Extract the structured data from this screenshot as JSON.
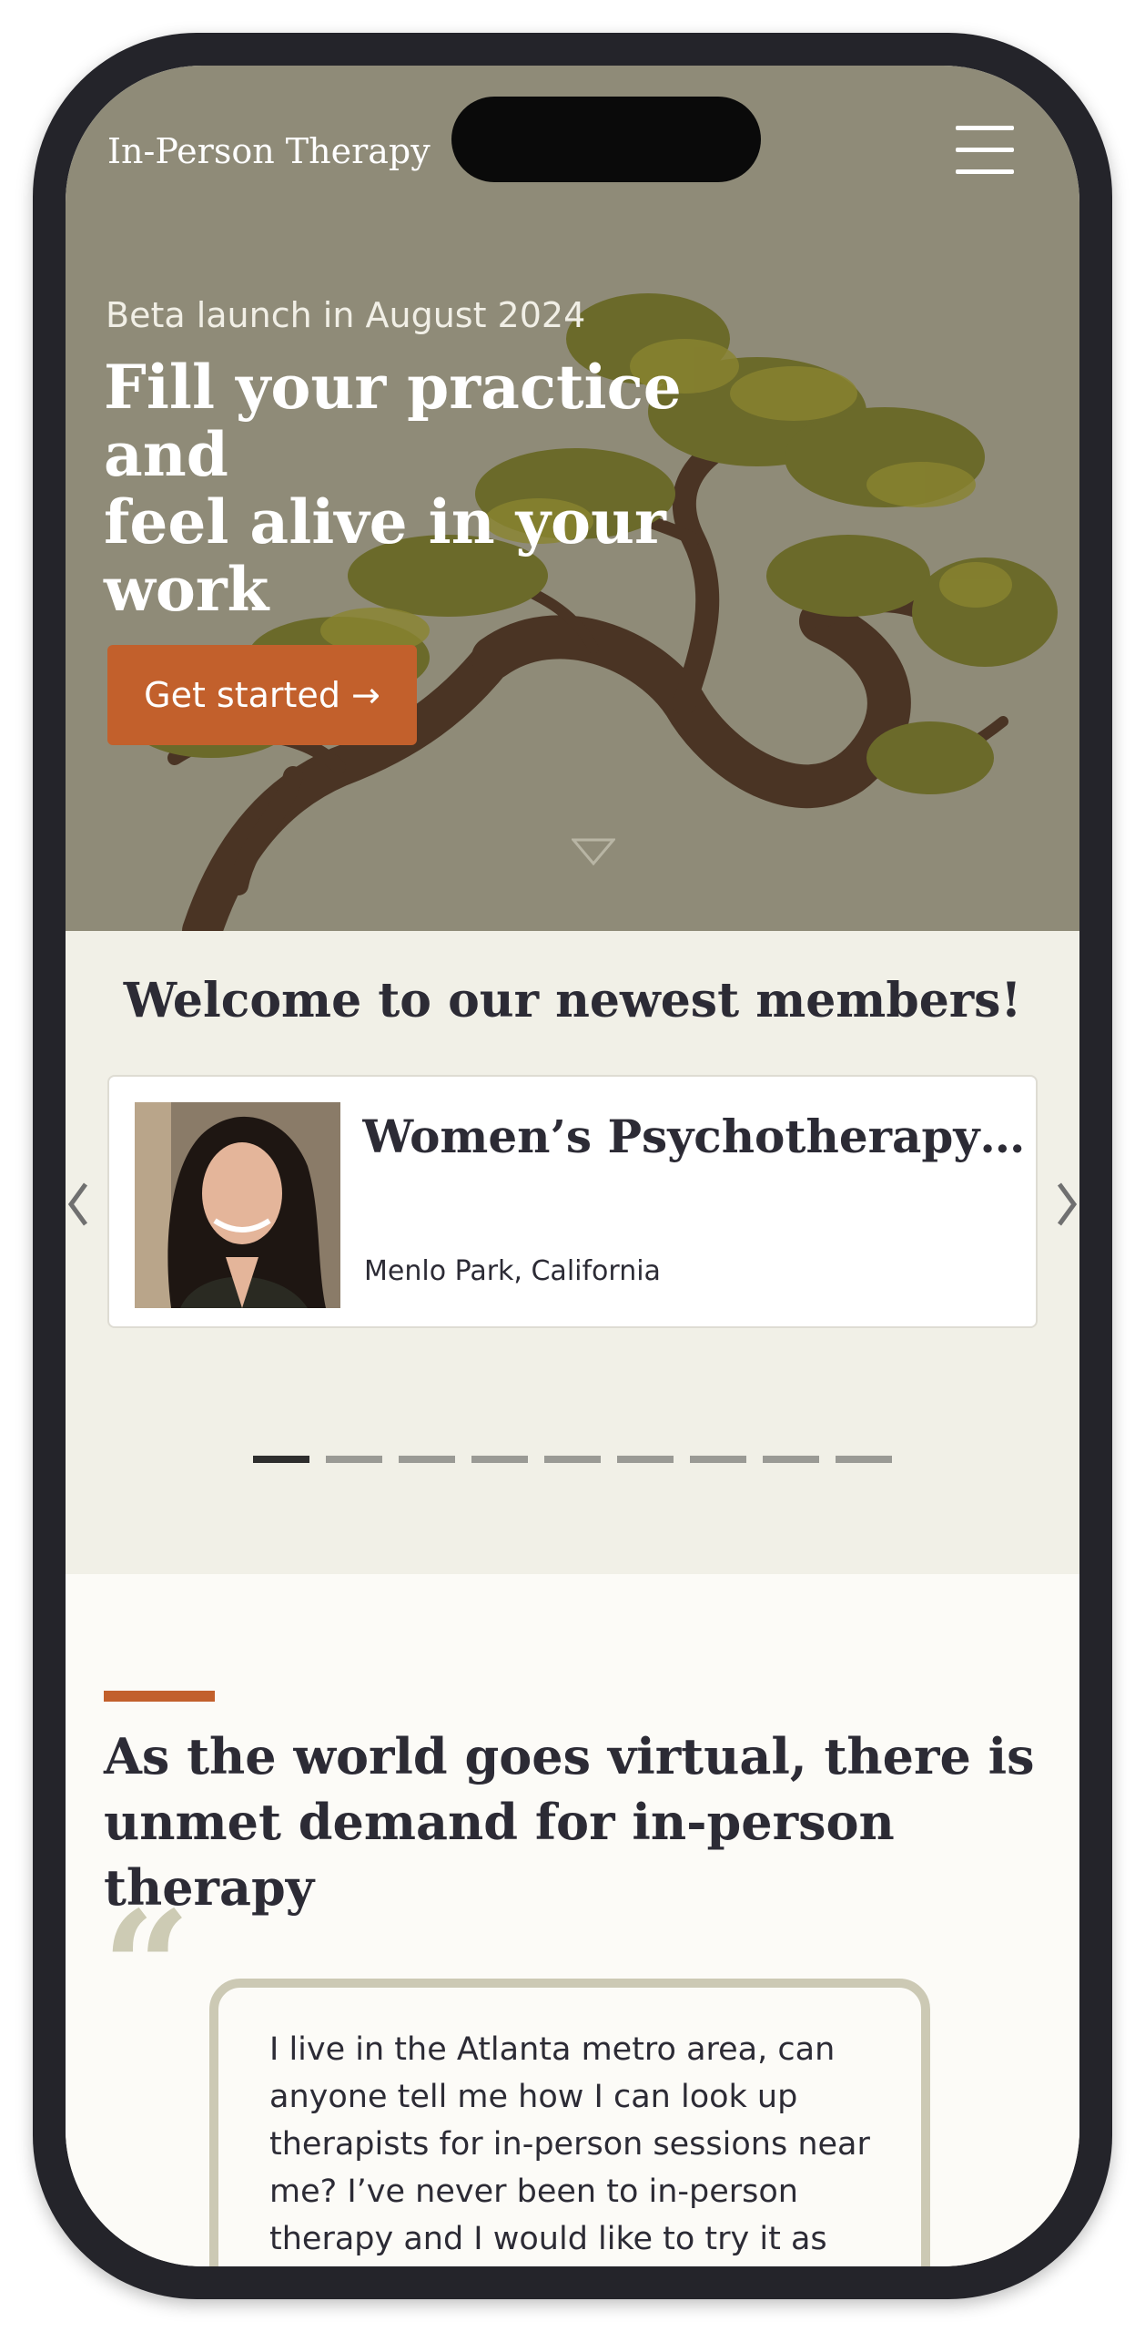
{
  "header": {
    "site_title": "In-Person Therapy",
    "menu_icon": "hamburger-menu-icon"
  },
  "hero": {
    "eyebrow": "Beta launch in August 2024",
    "headline_lines": [
      "Fill your practice and",
      "feel alive in your",
      "work"
    ],
    "cta_label": "Get started →",
    "scroll_icon": "chevron-down-icon"
  },
  "members": {
    "title": "Welcome to our newest members!",
    "card": {
      "name": "Women’s Psychotherapy & Wellness",
      "location": "Menlo Park, California"
    },
    "carousel": {
      "total_slides": 9,
      "active_slide": 1
    }
  },
  "virtual": {
    "title_lines": [
      "As the world goes virtual, there is",
      "unmet demand for in-person therapy"
    ],
    "quote_mark": "“",
    "quote_text": "I live in the Atlanta metro area, can anyone tell me how I can look up therapists for in-person sessions near me? I’ve never been to in-person therapy and I would like to try it as teletherapy isn’t helping that much."
  },
  "colors": {
    "accent": "#c2602c",
    "hero_bg": "#8f8b78",
    "members_bg": "#f1f0e7",
    "text_dark": "#2c2b35",
    "quote_border": "#ccc9b4"
  }
}
